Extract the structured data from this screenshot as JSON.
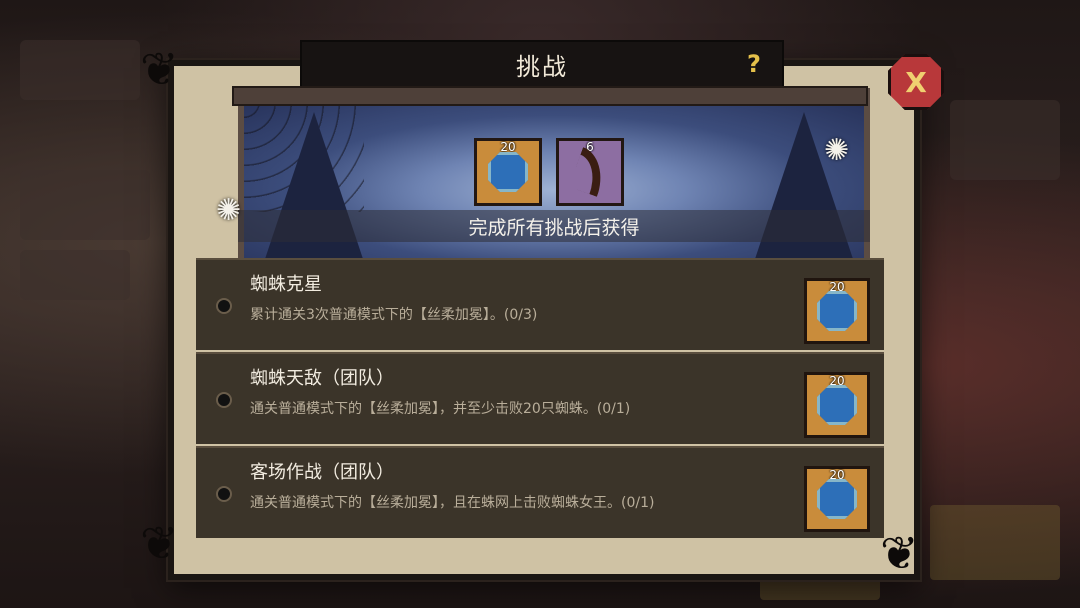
{
  "header": {
    "title": "挑战",
    "help_glyph": "?",
    "close_glyph": "X"
  },
  "banner": {
    "caption": "完成所有挑战后获得",
    "rewards": [
      {
        "icon": "blue-gem-icon",
        "count": "20"
      },
      {
        "icon": "claw-icon",
        "count": "6"
      }
    ]
  },
  "challenges": [
    {
      "name": "蜘蛛克星",
      "description": "累计通关3次普通模式下的【丝柔加冕】。(0/3)",
      "reward_count": "20",
      "reward_icon": "blue-gem-icon"
    },
    {
      "name": "蜘蛛天敌（团队）",
      "description": "通关普通模式下的【丝柔加冕】，并至少击败20只蜘蛛。(0/1)",
      "reward_count": "20",
      "reward_icon": "blue-gem-icon"
    },
    {
      "name": "客场作战（团队）",
      "description": "通关普通模式下的【丝柔加冕】，且在蛛网上击败蜘蛛女王。(0/1)",
      "reward_count": "20",
      "reward_icon": "blue-gem-icon"
    }
  ],
  "colors": {
    "panel": "#cfc2a4",
    "row": "#3b3429",
    "accent": "#e4c04a",
    "close": "#b8383a"
  }
}
